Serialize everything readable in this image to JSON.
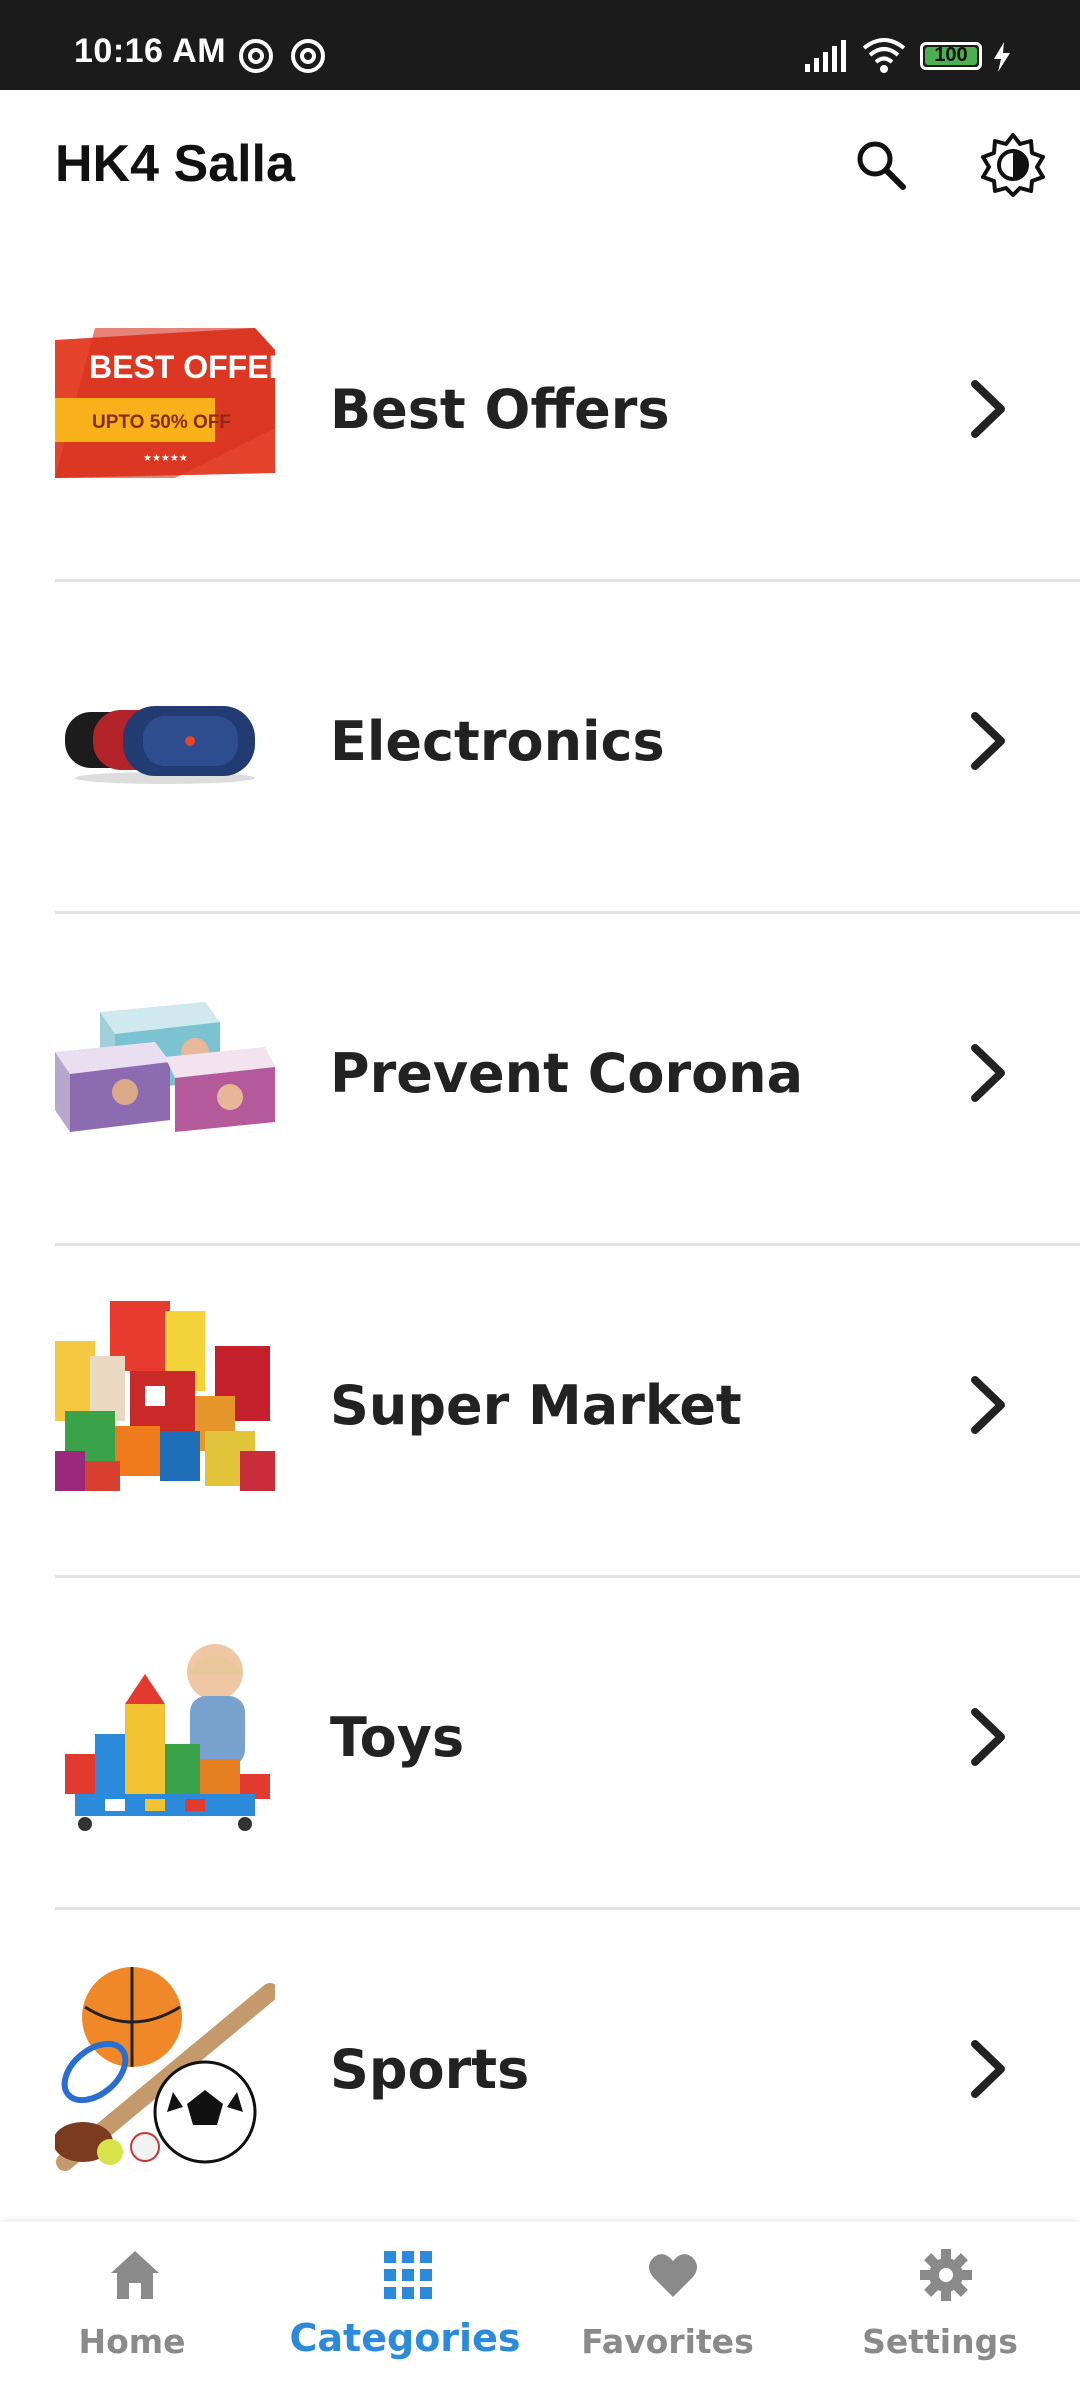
{
  "status_bar": {
    "time": "10:16 AM",
    "battery": "100"
  },
  "app_bar": {
    "title": "HK4 Salla",
    "search_icon": "search-icon",
    "theme_icon": "brightness-icon"
  },
  "categories": [
    {
      "label": "Best Offers",
      "thumb_text_1": "BEST OFFER",
      "thumb_text_2": "UPTO 50% OFF",
      "thumb_text_3": "★★★★★"
    },
    {
      "label": "Electronics"
    },
    {
      "label": "Prevent Corona"
    },
    {
      "label": "Super Market"
    },
    {
      "label": "Toys"
    },
    {
      "label": "Sports"
    }
  ],
  "bottom_nav": {
    "items": [
      {
        "label": "Home",
        "icon": "home-icon"
      },
      {
        "label": "Categories",
        "icon": "grid-icon",
        "active": true
      },
      {
        "label": "Favorites",
        "icon": "heart-icon"
      },
      {
        "label": "Settings",
        "icon": "gear-icon"
      }
    ],
    "active_color": "#2b8ad9",
    "inactive_color": "#8a8a8a"
  }
}
